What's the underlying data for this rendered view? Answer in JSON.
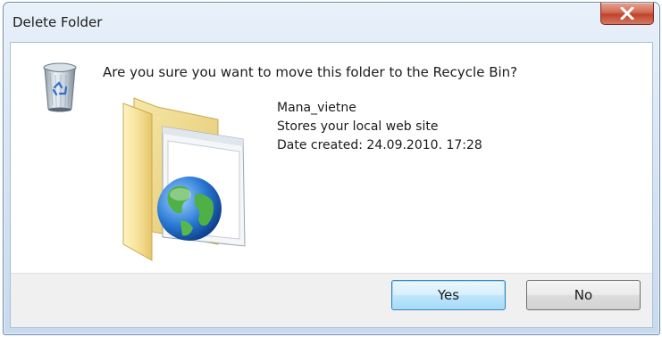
{
  "window": {
    "title": "Delete Folder",
    "close_icon": "close-icon"
  },
  "dialog": {
    "question": "Are you sure you want to move this folder to the Recycle Bin?",
    "recycle_icon": "recycle-bin-icon",
    "folder_icon": "web-folder-icon",
    "folder": {
      "name": "Mana_vietne",
      "description": "Stores your local web site",
      "date_created": "Date created: 24.09.2010. 17:28"
    }
  },
  "buttons": {
    "yes_label": "Yes",
    "no_label": "No"
  },
  "colors": {
    "close_button": "#c9502f",
    "default_button_border": "#3c7fb1",
    "footer_background": "#f0f0f0"
  }
}
